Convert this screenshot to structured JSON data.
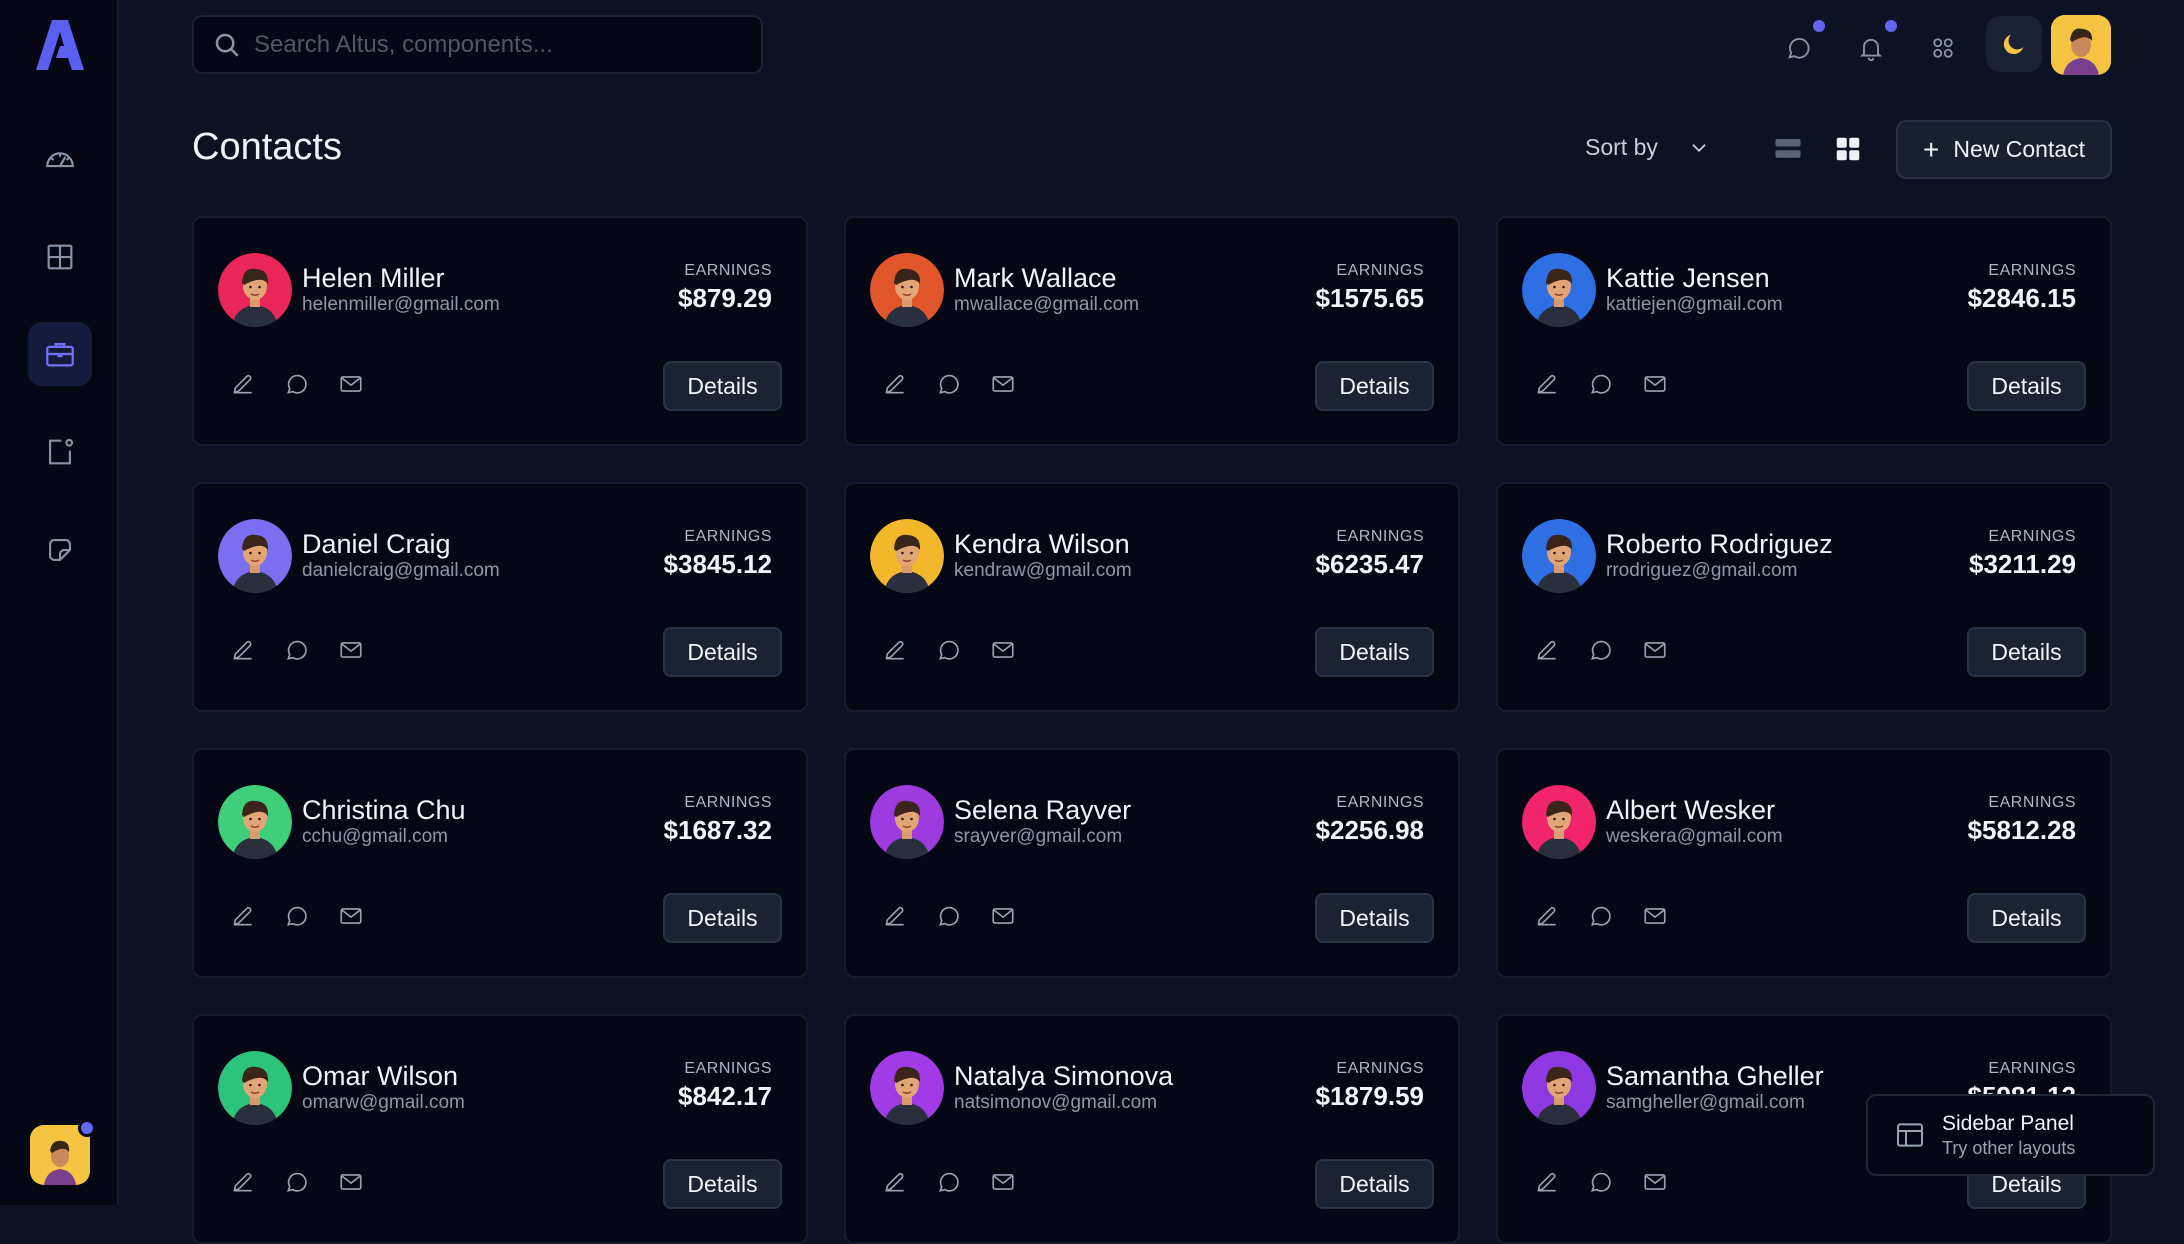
{
  "search": {
    "placeholder": "Search Altus, components..."
  },
  "header": {
    "title": "Contacts",
    "sort_label": "Sort by",
    "new_contact_label": "New Contact"
  },
  "colors": {
    "accent": "#6366f1",
    "background": "#0c1223",
    "card": "#050814"
  },
  "sidebar": {
    "items": [
      {
        "icon": "speedometer-icon"
      },
      {
        "icon": "grid-icon"
      },
      {
        "icon": "briefcase-icon",
        "active": true
      },
      {
        "icon": "notification-square-icon"
      },
      {
        "icon": "sticker-icon"
      }
    ]
  },
  "contacts": [
    {
      "name": "Helen Miller",
      "email": "helenmiller@gmail.com",
      "earnings_label": "EARNINGS",
      "earnings": "$879.29",
      "details": "Details",
      "avatar_bg": "#e8265a"
    },
    {
      "name": "Mark Wallace",
      "email": "mwallace@gmail.com",
      "earnings_label": "EARNINGS",
      "earnings": "$1575.65",
      "details": "Details",
      "avatar_bg": "#e0562a"
    },
    {
      "name": "Kattie Jensen",
      "email": "kattiejen@gmail.com",
      "earnings_label": "EARNINGS",
      "earnings": "$2846.15",
      "details": "Details",
      "avatar_bg": "#2f6fe4"
    },
    {
      "name": "Daniel Craig",
      "email": "danielcraig@gmail.com",
      "earnings_label": "EARNINGS",
      "earnings": "$3845.12",
      "details": "Details",
      "avatar_bg": "#7c6ef0"
    },
    {
      "name": "Kendra Wilson",
      "email": "kendraw@gmail.com",
      "earnings_label": "EARNINGS",
      "earnings": "$6235.47",
      "details": "Details",
      "avatar_bg": "#f3b72c"
    },
    {
      "name": "Roberto Rodriguez",
      "email": "rrodriguez@gmail.com",
      "earnings_label": "EARNINGS",
      "earnings": "$3211.29",
      "details": "Details",
      "avatar_bg": "#2f6fe4"
    },
    {
      "name": "Christina Chu",
      "email": "cchu@gmail.com",
      "earnings_label": "EARNINGS",
      "earnings": "$1687.32",
      "details": "Details",
      "avatar_bg": "#3fcf7a"
    },
    {
      "name": "Selena Rayver",
      "email": "srayver@gmail.com",
      "earnings_label": "EARNINGS",
      "earnings": "$2256.98",
      "details": "Details",
      "avatar_bg": "#9d3be0"
    },
    {
      "name": "Albert Wesker",
      "email": "weskera@gmail.com",
      "earnings_label": "EARNINGS",
      "earnings": "$5812.28",
      "details": "Details",
      "avatar_bg": "#f0256c"
    },
    {
      "name": "Omar Wilson",
      "email": "omarw@gmail.com",
      "earnings_label": "EARNINGS",
      "earnings": "$842.17",
      "details": "Details",
      "avatar_bg": "#2cc47a"
    },
    {
      "name": "Natalya Simonova",
      "email": "natsimonov@gmail.com",
      "earnings_label": "EARNINGS",
      "earnings": "$1879.59",
      "details": "Details",
      "avatar_bg": "#a03be6"
    },
    {
      "name": "Samantha Gheller",
      "email": "samgheller@gmail.com",
      "earnings_label": "EARNINGS",
      "earnings": "$5981.12",
      "details": "Details",
      "avatar_bg": "#8d38e0"
    }
  ],
  "panel_toast": {
    "title": "Sidebar Panel",
    "subtitle": "Try other layouts"
  }
}
